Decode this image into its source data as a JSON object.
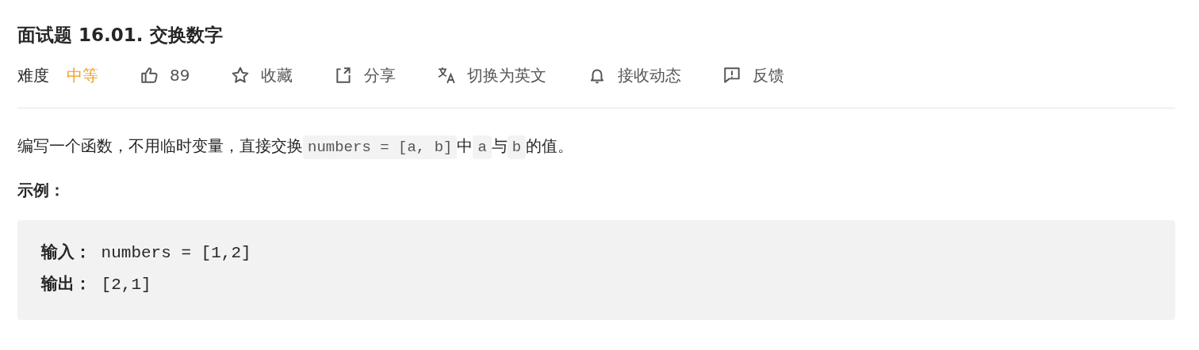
{
  "title": "面试题 16.01. 交换数字",
  "difficulty": {
    "label": "难度",
    "value": "中等",
    "color": "#f0a020"
  },
  "actions": [
    {
      "kind": "like",
      "label": "89"
    },
    {
      "kind": "star",
      "label": "收藏"
    },
    {
      "kind": "share",
      "label": "分享"
    },
    {
      "kind": "translate",
      "label": "切换为英文"
    },
    {
      "kind": "bell",
      "label": "接收动态"
    },
    {
      "kind": "feedback",
      "label": "反馈"
    }
  ],
  "description": [
    {
      "kind": "text",
      "text": "编写一个函数，不用临时变量，直接交换"
    },
    {
      "kind": "code",
      "text": "numbers = [a, b]"
    },
    {
      "kind": "text",
      "text": "中"
    },
    {
      "kind": "code",
      "text": "a"
    },
    {
      "kind": "text",
      "text": "与"
    },
    {
      "kind": "code",
      "text": "b"
    },
    {
      "kind": "text",
      "text": "的值。"
    }
  ],
  "example_heading": "示例：",
  "example_lines": [
    "**输入：** numbers = [1,2]",
    "**输出：** [2,1]"
  ]
}
